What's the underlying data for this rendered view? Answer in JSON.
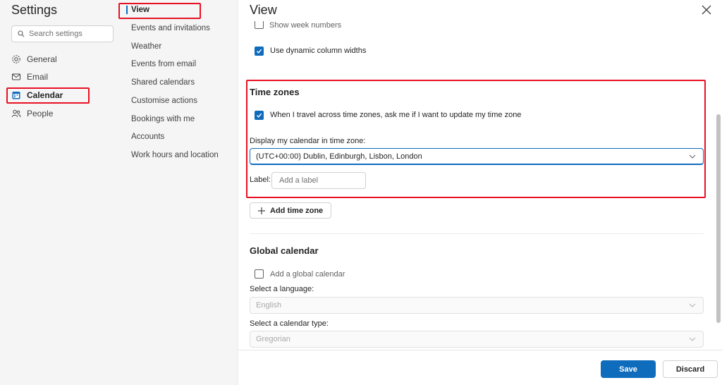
{
  "settings": {
    "title": "Settings",
    "search_placeholder": "Search settings",
    "nav": [
      {
        "label": "General",
        "icon": "gear-icon"
      },
      {
        "label": "Email",
        "icon": "mail-icon"
      },
      {
        "label": "Calendar",
        "icon": "calendar-icon",
        "active": true
      },
      {
        "label": "People",
        "icon": "people-icon"
      }
    ]
  },
  "subnav": {
    "items": [
      {
        "label": "View",
        "active": true
      },
      {
        "label": "Events and invitations"
      },
      {
        "label": "Weather"
      },
      {
        "label": "Events from email"
      },
      {
        "label": "Shared calendars"
      },
      {
        "label": "Customise actions"
      },
      {
        "label": "Bookings with me"
      },
      {
        "label": "Accounts"
      },
      {
        "label": "Work hours and location"
      }
    ]
  },
  "content": {
    "title": "View",
    "show_week_numbers": {
      "label": "Show week numbers",
      "checked": false
    },
    "dynamic_widths": {
      "label": "Use dynamic column widths",
      "checked": true
    },
    "time_zones": {
      "title": "Time zones",
      "travel_prompt": {
        "label": "When I travel across time zones, ask me if I want to update my time zone",
        "checked": true
      },
      "display_label": "Display my calendar in time zone:",
      "selected_zone": "(UTC+00:00) Dublin, Edinburgh, Lisbon, London",
      "label_caption": "Label:",
      "label_placeholder": "Add a label",
      "add_button": "Add time zone"
    },
    "global_calendar": {
      "title": "Global calendar",
      "add_global": {
        "label": "Add a global calendar",
        "checked": false
      },
      "language_label": "Select a language:",
      "language_value": "English",
      "type_label": "Select a calendar type:",
      "type_value": "Gregorian"
    }
  },
  "footer": {
    "save": "Save",
    "discard": "Discard"
  },
  "colors": {
    "accent": "#0f6cbd",
    "highlight_box": "#e81123"
  }
}
